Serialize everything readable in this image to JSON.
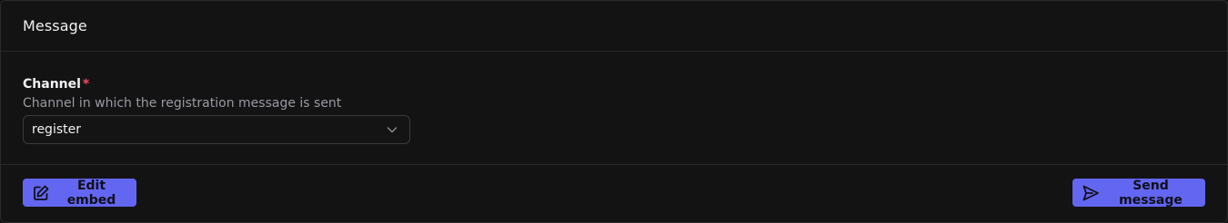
{
  "card": {
    "title": "Message"
  },
  "channel_field": {
    "label": "Channel",
    "required_marker": "*",
    "help_text": "Channel in which the registration message is sent",
    "selected_value": "register",
    "icon": "chevron-down-icon"
  },
  "footer": {
    "edit_embed": {
      "label": "Edit embed",
      "icon": "edit-icon"
    },
    "send_message": {
      "label": "Send message",
      "icon": "send-icon"
    }
  },
  "colors": {
    "background": "#131314",
    "border": "#2a2a2d",
    "accent": "#6366f1",
    "required": "#f04b62",
    "muted_text": "#9a9aa2"
  }
}
